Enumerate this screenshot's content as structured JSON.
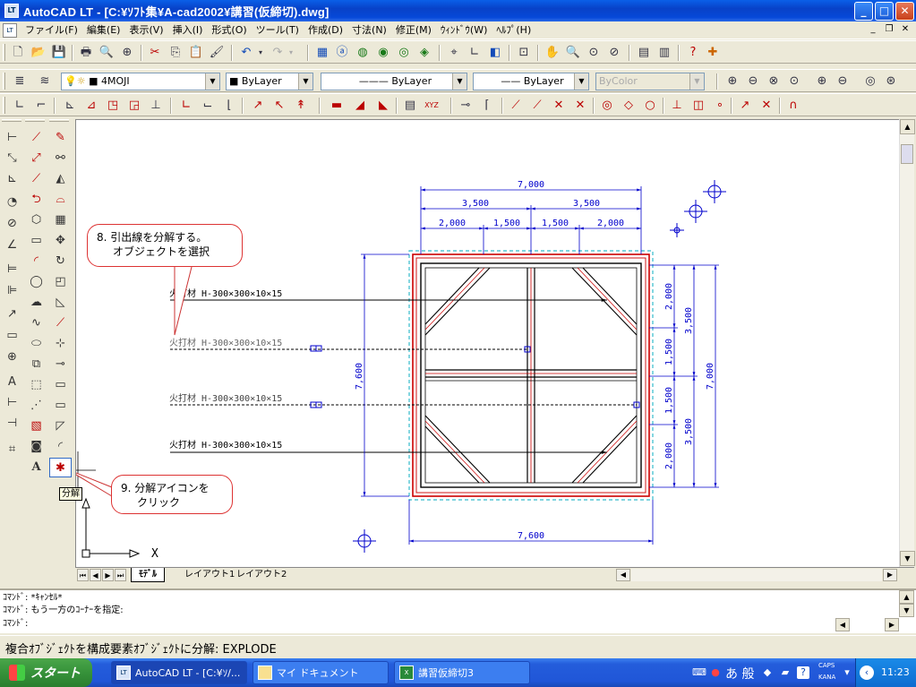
{
  "window": {
    "title": "AutoCAD LT - [C:¥ｿﾌﾄ集¥A-cad2002¥講習(仮締切).dwg]",
    "app_icon": "LT"
  },
  "menu": {
    "items": [
      {
        "label": "ファイル(F)"
      },
      {
        "label": "編集(E)"
      },
      {
        "label": "表示(V)"
      },
      {
        "label": "挿入(I)"
      },
      {
        "label": "形式(O)"
      },
      {
        "label": "ツール(T)"
      },
      {
        "label": "作成(D)"
      },
      {
        "label": "寸法(N)"
      },
      {
        "label": "修正(M)"
      },
      {
        "label": "ｳｨﾝﾄﾞｳ(W)"
      },
      {
        "label": "ﾍﾙﾌﾟ(H)"
      }
    ]
  },
  "layer_toolbar": {
    "layer_name": "4MOJI",
    "color": "ByLayer",
    "linetype": "ByLayer",
    "lineweight": "ByLayer",
    "plotstyle": "ByColor"
  },
  "drawing": {
    "labels": {
      "beam_1": "火打材 H-300×300×10×15",
      "beam_2": "火打材 H-300×300×10×15",
      "beam_3": "火打材 H-300×300×10×15",
      "beam_4": "火打材 H-300×300×10×15"
    },
    "dims_top": {
      "overall": "7,000",
      "half_left": "3,500",
      "half_right": "3,500",
      "seg1": "2,000",
      "seg2": "1,500",
      "seg3": "1,500",
      "seg4": "2,000"
    },
    "dims_right": {
      "seg1": "2,000",
      "seg2": "1,500",
      "seg3": "1,500",
      "seg4": "2,000",
      "half_top": "3,500",
      "half_bottom": "3,500",
      "overall": "7,000"
    },
    "dim_left": "7,600",
    "dim_bottom": "7,600",
    "ucs_x_label": "X"
  },
  "callouts": {
    "step8_line1": "8. 引出線を分解する。",
    "step8_line2": "オブジェクトを選択",
    "step9_line1": "9. 分解アイコンを",
    "step9_line2": "クリック",
    "tooltip": "分解"
  },
  "layout_tabs": [
    {
      "label": "ﾓﾃﾞﾙ"
    },
    {
      "label": "レイアウト1"
    },
    {
      "label": "レイアウト2"
    }
  ],
  "command": {
    "line1": "ｺﾏﾝﾄﾞ: *ｷｬﾝｾﾙ*",
    "line2": "ｺﾏﾝﾄﾞ: もう一方のｺｰﾅｰを指定:",
    "line3": "ｺﾏﾝﾄﾞ:"
  },
  "status_text": "複合ｵﾌﾞｼﾞｪｸﾄを構成要素ｵﾌﾞｼﾞｪｸﾄに分解: EXPLODE",
  "taskbar": {
    "start_label": "スタート",
    "buttons": [
      {
        "label": "AutoCAD LT - [C:¥ｿ/..."
      },
      {
        "label": "マイ ドキュメント"
      },
      {
        "label": "講習仮締切3"
      }
    ],
    "ime_text": "あ 般",
    "caps": "CAPS",
    "kana": "KANA",
    "clock": "11:23"
  },
  "colors": {
    "title_blue": "#0842c8",
    "cad_dim_blue": "#0000cc",
    "cad_red": "#cc0000",
    "taskbar_blue": "#245ddb",
    "start_green": "#36923a"
  }
}
